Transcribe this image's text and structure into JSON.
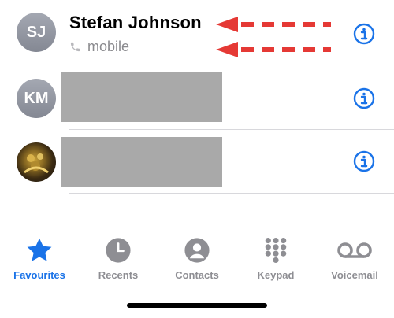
{
  "favourites": [
    {
      "initials": "SJ",
      "name": "Stefan Johnson",
      "label": "mobile",
      "redacted": false
    },
    {
      "initials": "KM",
      "name": "",
      "label": "",
      "redacted": true
    },
    {
      "initials": "",
      "name": "",
      "label": "",
      "redacted": true,
      "photo": true
    }
  ],
  "tabbar": {
    "tabs": [
      {
        "label": "Favourites",
        "icon": "star-icon",
        "active": true
      },
      {
        "label": "Recents",
        "icon": "clock-icon",
        "active": false
      },
      {
        "label": "Contacts",
        "icon": "person-circle-icon",
        "active": false
      },
      {
        "label": "Keypad",
        "icon": "keypad-icon",
        "active": false
      },
      {
        "label": "Voicemail",
        "icon": "voicemail-icon",
        "active": false
      }
    ]
  },
  "colors": {
    "accent": "#1a73e8",
    "annotation_arrow": "#e53935",
    "inactive": "#8e8e93",
    "redaction": "#a9a9a9"
  }
}
